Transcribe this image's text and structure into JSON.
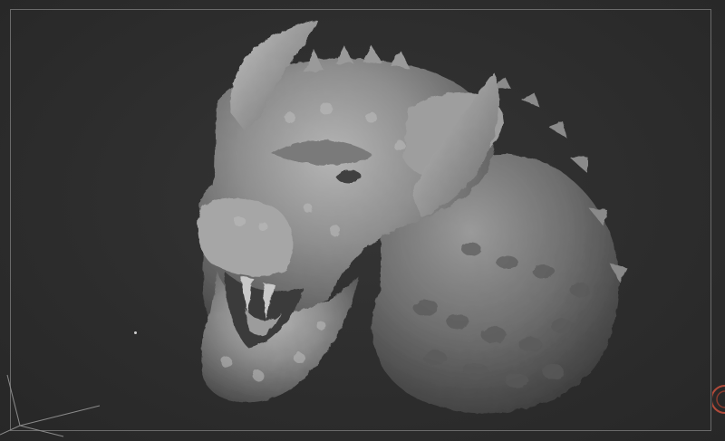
{
  "viewport": {
    "mode": "sculpt-3d-viewport",
    "background_color": "#2d2d2d",
    "frame_color": "#6a6a6a",
    "model_base_color": "#8c8c8c"
  },
  "model": {
    "icon": "dragon-head-sculpt"
  },
  "gizmo": {
    "icon": "axis-orientation-gizmo"
  },
  "edge_widget": {
    "icon": "circular-widget-fragment",
    "color": "#b24a3a"
  }
}
